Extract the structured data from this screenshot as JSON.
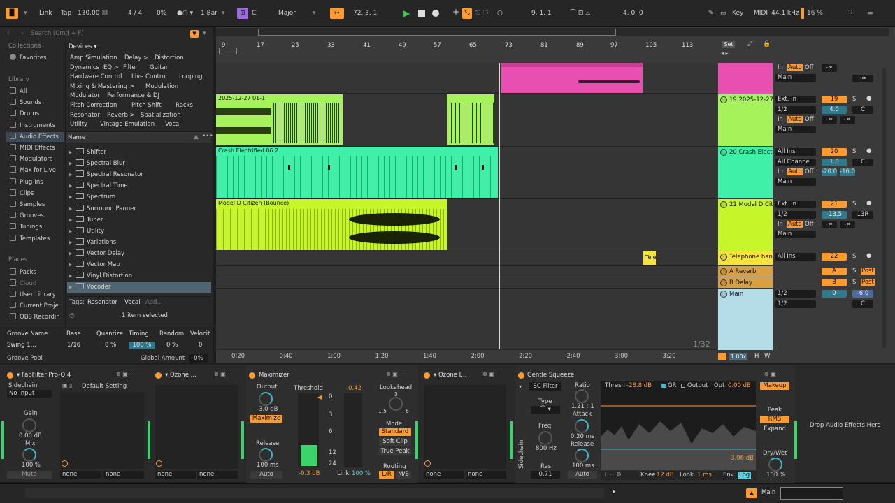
{
  "topbar": {
    "link": "Link",
    "tap": "Tap",
    "tempo": "130.00",
    "time_sig_num": "4",
    "time_sig_den": "4",
    "swing": "0%",
    "quantize": "1 Bar",
    "key_root": "C",
    "scale": "Major",
    "position": "72.  3.  1",
    "loop_start": "9.  1.  1",
    "loop_length": "4.  0.  0",
    "key_label": "Key",
    "midi_label": "MIDI",
    "sample_rate": "44.1 kHz",
    "cpu": "16 %"
  },
  "browser": {
    "search_placeholder": "Search (Cmd + F)",
    "collections_head": "Collections",
    "favorites": "Favorites",
    "library_head": "Library",
    "library_items": [
      "All",
      "Sounds",
      "Drums",
      "Instruments",
      "Audio Effects",
      "MIDI Effects",
      "Modulators",
      "Max for Live",
      "Plug-Ins",
      "Clips",
      "Samples",
      "Grooves",
      "Tunings",
      "Templates"
    ],
    "places_head": "Places",
    "places_items": [
      "Packs",
      "Cloud",
      "User Library",
      "Current Proje",
      "OBS Recordin"
    ],
    "devices_label": "Devices ▾",
    "tags": [
      [
        "Amp Simulation",
        "Delay >",
        "Distortion"
      ],
      [
        "Dynamics",
        "EQ >",
        "Filter",
        "Guitar"
      ],
      [
        "Hardware Control",
        "Live Control",
        "Looping"
      ],
      [
        "Mixing & Mastering >",
        "Modulation"
      ],
      [
        "Modulator",
        "Performance & DJ"
      ],
      [
        "Pitch Correction",
        "Pitch Shift",
        "Racks"
      ],
      [
        "Resonator",
        "Reverb >",
        "Spatialization"
      ],
      [
        "Utility",
        "Vintage Emulation",
        "Vocal"
      ]
    ],
    "name_header": "Name",
    "list": [
      "Shifter",
      "Spectral Blur",
      "Spectral Resonator",
      "Spectral Time",
      "Spectrum",
      "Surround Panner",
      "Tuner",
      "Utility",
      "Variations",
      "Vector Delay",
      "Vector Map",
      "Vinyl Distortion",
      "Vocoder"
    ],
    "tags_label": "Tags:",
    "tag1": "Resonator",
    "tag2": "Vocal",
    "tag_add": "Add...",
    "selection": "1 item selected",
    "groove_headers": [
      "Groove Name",
      "Base",
      "Quantize",
      "Timing",
      "Random",
      "Velocit"
    ],
    "groove_row": [
      "Swing 1...",
      "1/16",
      "0 %",
      "100 %",
      "0 %",
      "0"
    ],
    "groove_pool": "Groove Pool",
    "global_amount_label": "Global Amount",
    "global_amount": "0%"
  },
  "arrangement": {
    "bars": [
      "9",
      "17",
      "25",
      "33",
      "41",
      "49",
      "57",
      "65",
      "73",
      "81",
      "89",
      "97",
      "105",
      "113"
    ],
    "times": [
      "0:20",
      "0:40",
      "1:00",
      "1:20",
      "1:40",
      "2:00",
      "2:20",
      "2:40",
      "3:00",
      "3:20"
    ],
    "set_label": "Set",
    "clips": {
      "audio1": "2025-12-27 01-1",
      "crash": "Crash Electrified 06 2",
      "model": "Model D Citizen (Bounce)",
      "tele": "Tele"
    },
    "page_count": "1/32",
    "zoom": "1.00x",
    "h": "H",
    "w": "W"
  },
  "tracks": [
    {
      "name": "",
      "color": "#e84fae",
      "in1": "In",
      "in2": "Auto",
      "in3": "Off",
      "vol": "-∞",
      "pan": "-∞",
      "out": "Main"
    },
    {
      "name": "19 2025-12-27",
      "color": "#a6f25b",
      "input": "Ext. In",
      "chan": "1/2",
      "num": "19",
      "val": "4.0",
      "pan": "C",
      "vol": "-∞",
      "pan2": "-∞",
      "out": "Main"
    },
    {
      "name": "20 Crash Elect",
      "color": "#3ff0a8",
      "input": "All Ins",
      "chan": "All Channe",
      "num": "20",
      "val": "1.0",
      "pan": "C",
      "vol": "-20.0",
      "pan2": "-16.0",
      "out": "Main"
    },
    {
      "name": "21 Model D Cit",
      "color": "#c6f52a",
      "input": "Ext. In",
      "chan": "1/2",
      "num": "21",
      "val": "-13.5",
      "pan": "13R",
      "vol": "-∞",
      "pan2": "-∞",
      "out": "Main"
    },
    {
      "name": "Telephone han",
      "color": "#f5e33c",
      "input": "All Ins",
      "num": "22"
    },
    {
      "name": "A Reverb",
      "color": "#d8a040",
      "num": "A",
      "post": "Post"
    },
    {
      "name": "B Delay",
      "color": "#d8a040",
      "num": "B",
      "post": "Post"
    },
    {
      "name": "Main",
      "color": "#b5dde8",
      "chan": "1/2",
      "chan2": "1/2",
      "val": "0",
      "vol": "-6.0",
      "pan": "C"
    }
  ],
  "io_labels": {
    "in": "In",
    "auto": "Auto",
    "off": "Off",
    "s": "S"
  },
  "devices": {
    "proq": {
      "title": "FabFilter Pro-Q 4",
      "sidechain": "Sidechain",
      "no_input": "No Input",
      "gain_label": "Gain",
      "gain": "0.00 dB",
      "mix_label": "Mix",
      "mix": "100 %",
      "mute": "Mute",
      "preset": "Default Setting",
      "none1": "none",
      "none2": "none"
    },
    "ozone1": {
      "title": "Ozone ...",
      "none1": "none",
      "none2": "none"
    },
    "maximizer": {
      "title": "Maximizer",
      "output_label": "Output",
      "output": "-3.0 dB",
      "maximize": "Maximize",
      "release_label": "Release",
      "release": "100 ms",
      "auto": "Auto",
      "threshold_label": "Threshold",
      "threshold": "-0.42",
      "gr": "-0.3 dB",
      "scale": [
        "0",
        "3",
        "6",
        "12",
        "24"
      ],
      "link_label": "Link",
      "link": "100 %",
      "lookahead_label": "Lookahead",
      "lookahead": "3",
      "la_min": "1.5",
      "la_max": "6",
      "mode_label": "Mode",
      "standard": "Standard",
      "soft_clip": "Soft Clip",
      "true_peak": "True Peak",
      "routing_label": "Routing",
      "lr": "L/R",
      "ms": "M/S"
    },
    "ozone2": {
      "title": "Ozone I...",
      "none1": "none",
      "none2": "none"
    },
    "squeeze": {
      "title": "Gentle Squeeze",
      "sc_filter": "SC Filter",
      "type_label": "Type",
      "freq_label": "Freq",
      "freq": "800 Hz",
      "res_label": "Res",
      "res": "0.71",
      "sidechain": "Sidechain",
      "ratio_label": "Ratio",
      "ratio": "1.21 : 1",
      "attack_label": "Attack",
      "attack": "0.20 ms",
      "release_label": "Release",
      "release": "100 ms",
      "auto": "Auto",
      "thresh_label": "Thresh",
      "thresh": "-28.8 dB",
      "gr": "GR",
      "output_label": "Output",
      "out_label": "Out",
      "out": "0.00 dB",
      "gr_value": "-3.06 dB",
      "knee_label": "Knee",
      "knee": "12 dB",
      "look_label": "Look.",
      "look": "1 ms",
      "env_label": "Env.",
      "log": "Log",
      "makeup": "Makeup",
      "peak": "Peak",
      "rms": "RMS",
      "expand": "Expand",
      "drywet_label": "Dry/Wet",
      "drywet": "100 %"
    },
    "drop": "Drop Audio Effects Here"
  },
  "status": {
    "main": "Main"
  }
}
